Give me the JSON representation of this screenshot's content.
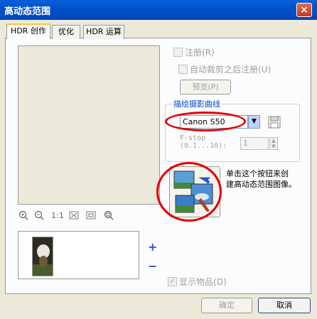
{
  "window": {
    "title": "高动态范围",
    "close_label": "×"
  },
  "tabs": [
    {
      "label": "HDR 创作",
      "active": true
    },
    {
      "label": "优化",
      "active": false
    },
    {
      "label": "HDR 运算",
      "active": false
    }
  ],
  "zoom_toolbar": {
    "zoom_in_icon": "zoom-in-icon",
    "zoom_out_icon": "zoom-out-icon",
    "actual_size_label": "1:1",
    "fit_icon": "fit-window-icon",
    "fullscreen_icon": "fullscreen-icon",
    "zoom_region_icon": "zoom-region-icon"
  },
  "register": {
    "checkbox_label": "注册",
    "checkbox_hotkey": "(R)",
    "auto_crop_label": "自动裁剪之后注册",
    "auto_crop_hotkey": "(U)",
    "preview_button": "预览",
    "preview_hotkey": "(P)"
  },
  "camera_curve": {
    "group_label": "描绘摄影曲线",
    "camera_value": "Canon S50",
    "fstop_label_line1": "F-stop",
    "fstop_label_line2": "(0.1...10):",
    "fstop_value": "1"
  },
  "hdr_action": {
    "hint_line1": "单击这个按钮来创",
    "hint_line2": "建高动态范围图像。"
  },
  "thumbs": {
    "add_label": "+",
    "remove_label": "−"
  },
  "show_items": {
    "label": "显示物品",
    "hotkey": "(D)"
  },
  "buttons": {
    "ok": "确定",
    "cancel": "取消"
  },
  "colors": {
    "title_bar": "#0052cc",
    "highlight_oval": "#e00000",
    "tab_accent": "#ffc73c"
  }
}
